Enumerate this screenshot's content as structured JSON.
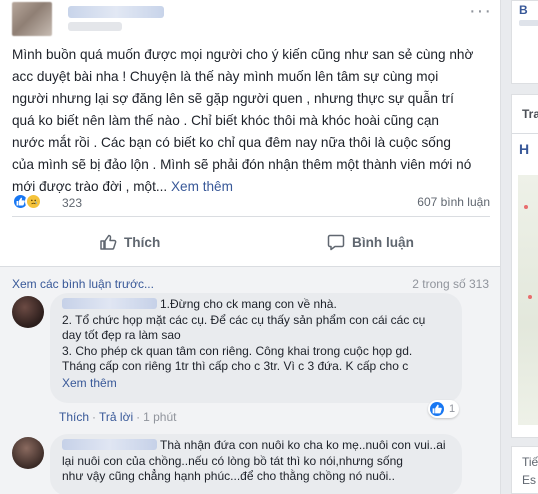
{
  "post": {
    "text_lines": [
      "Mình buồn quá muốn được mọi người cho ý kiến cũng như san sẻ cùng nhờ",
      "acc duyệt bài nha ! Chuyện là thế này mình muốn lên tâm sự cùng mọi",
      "người nhưng lại sợ đăng lên sẽ gặp người quen , nhưng thực sự quẫn trí",
      "quá ko biết nên làm thế nào . Chỉ biết khóc thôi mà khóc hoài cũng cạn",
      "nước mắt rồi . Các bạn có biết ko chỉ qua đêm nay nữa thôi là cuộc sống",
      "của mình sẽ bị đảo lộn . Mình sẽ phải đón nhận thêm một thành viên mới nó",
      "mới được trào đời , một..."
    ],
    "see_more": "Xem thêm",
    "reaction_count": "323",
    "comment_count": "607 bình luận",
    "reactions": [
      "like",
      "sad"
    ]
  },
  "actions": {
    "like_label": "Thích",
    "comment_label": "Bình luận"
  },
  "comments": {
    "view_previous": "Xem các bình luận trước...",
    "page_count": "2 trong số 313",
    "items": [
      {
        "text": "1.Đừng cho ck mang con về nhà.\n2. Tổ chức họp mặt các cụ. Để các cụ thấy sản phẩm con cái các cụ\nday tốt đẹp ra làm sao\n3. Cho phép ck quan tâm con riêng. Công khai trong cuộc họp gd.\nTháng cấp con riêng 1tr thì cấp cho c 3tr. Vì c 3 đứa. K cấp cho c",
        "see_more": "Xem thêm",
        "like_count": "1",
        "like_label": "Thích",
        "reply_label": "Trả lời",
        "time": "1 phút"
      },
      {
        "text": "Thà nhận đứa con nuôi ko cha ko mẹ..nuôi con vui..ai\nlại nuôi con của chồng..nếu có lòng bồ tát thì ko nói,nhưng sống\nnhư vậy cũng chẳng hạnh phúc...để cho thằng chồng nó nuôi.."
      }
    ]
  },
  "right_column": {
    "top_letter": "B",
    "mid_title": "Tra",
    "mid_heading": "H",
    "bottom_line1": "Tiế",
    "bottom_line2": "Es"
  },
  "colors": {
    "link": "#385898",
    "like_blue": "#1877f2",
    "sad_yellow": "#f5c33b",
    "comment_bg": "#f2f3f5",
    "bubble_bg": "#e9ebee"
  }
}
